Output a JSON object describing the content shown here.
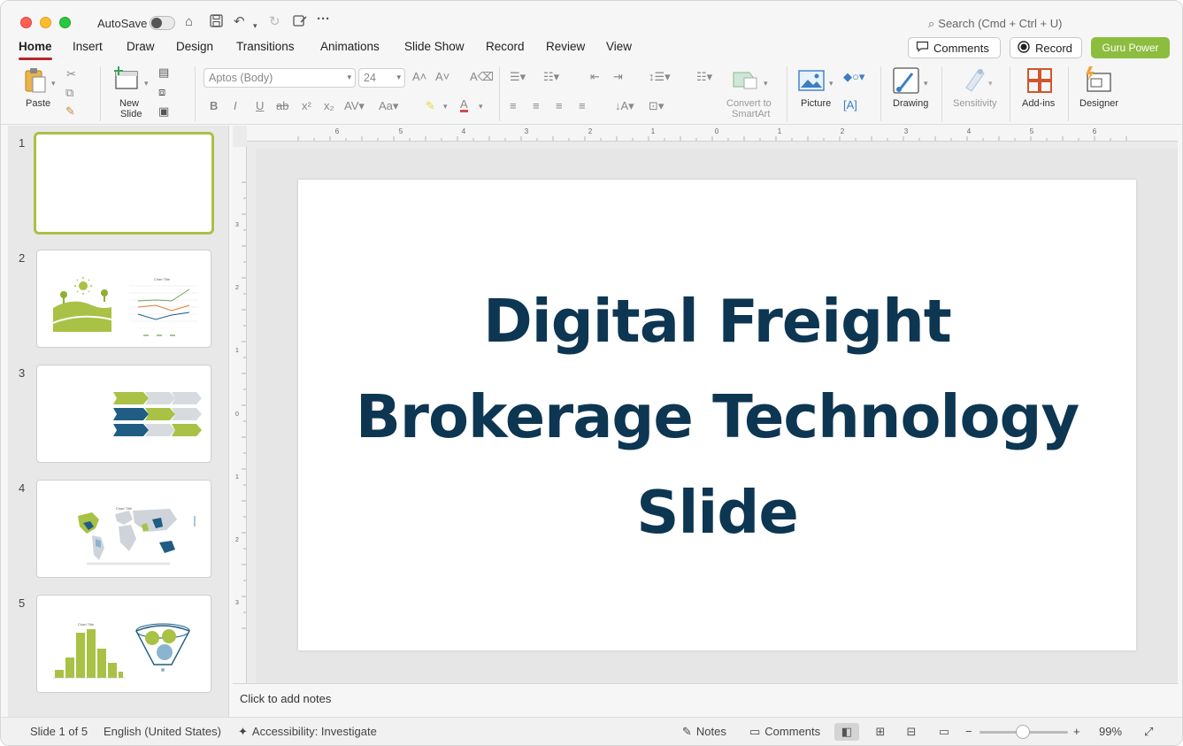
{
  "titlebar": {
    "autosave_label": "AutoSave",
    "search_placeholder": "Search (Cmd + Ctrl + U)"
  },
  "tabs": [
    "Home",
    "Insert",
    "Draw",
    "Design",
    "Transitions",
    "Animations",
    "Slide Show",
    "Record",
    "Review",
    "View"
  ],
  "active_tab": "Home",
  "top_buttons": {
    "comments": "Comments",
    "record": "Record",
    "guru_power": "Guru Power"
  },
  "ribbon": {
    "paste": "Paste",
    "new_slide_line1": "New",
    "new_slide_line2": "Slide",
    "font_name": "Aptos (Body)",
    "font_size": "24",
    "convert_line1": "Convert to",
    "convert_line2": "SmartArt",
    "picture": "Picture",
    "drawing": "Drawing",
    "sensitivity": "Sensitivity",
    "add_ins": "Add-ins",
    "designer": "Designer"
  },
  "ruler": {
    "h_ticks": [
      "6",
      "5",
      "4",
      "3",
      "2",
      "1",
      "0",
      "1",
      "2",
      "3",
      "4",
      "5",
      "6"
    ],
    "v_ticks": [
      "3",
      "2",
      "1",
      "0",
      "1",
      "2",
      "3"
    ]
  },
  "thumbnails": [
    {
      "number": "1"
    },
    {
      "number": "2",
      "chart_title": "Chart Title"
    },
    {
      "number": "3"
    },
    {
      "number": "4",
      "chart_title": "Chart Title"
    },
    {
      "number": "5",
      "chart_title": "Chart Title"
    }
  ],
  "slide": {
    "title_line1": "Digital Freight",
    "title_line2": "Brokerage Technology",
    "title_line3": "Slide"
  },
  "notes_placeholder": "Click to add notes",
  "status": {
    "slide_position": "Slide 1 of 5",
    "language": "English (United States)",
    "accessibility": "Accessibility: Investigate",
    "notes": "Notes",
    "comments": "Comments",
    "zoom": "99%"
  },
  "colors": {
    "accent_red": "#b5262b",
    "guru_green": "#8cbd3f",
    "title_navy": "#0d3652",
    "thumb_green": "#a9c145",
    "thumb_blue": "#1f5d84"
  }
}
